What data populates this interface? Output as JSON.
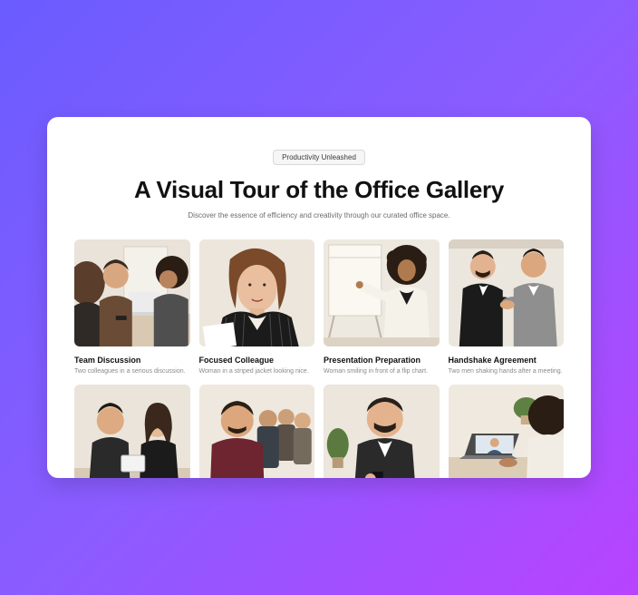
{
  "header": {
    "pill": "Productivity Unleashed",
    "title": "A Visual Tour of the Office Gallery",
    "subtitle": "Discover the essence of efficiency and creativity through our curated office space."
  },
  "gallery": [
    {
      "title": "Team Discussion",
      "desc": "Two colleagues in a serious discussion."
    },
    {
      "title": "Focused Colleague",
      "desc": "Woman in a striped jacket looking nice."
    },
    {
      "title": "Presentation Preparation",
      "desc": "Woman smiling in front of a flip chart."
    },
    {
      "title": "Handshake Agreement",
      "desc": "Two men shaking hands after a meeting."
    },
    {
      "title": "",
      "desc": ""
    },
    {
      "title": "",
      "desc": ""
    },
    {
      "title": "",
      "desc": ""
    },
    {
      "title": "",
      "desc": ""
    }
  ]
}
